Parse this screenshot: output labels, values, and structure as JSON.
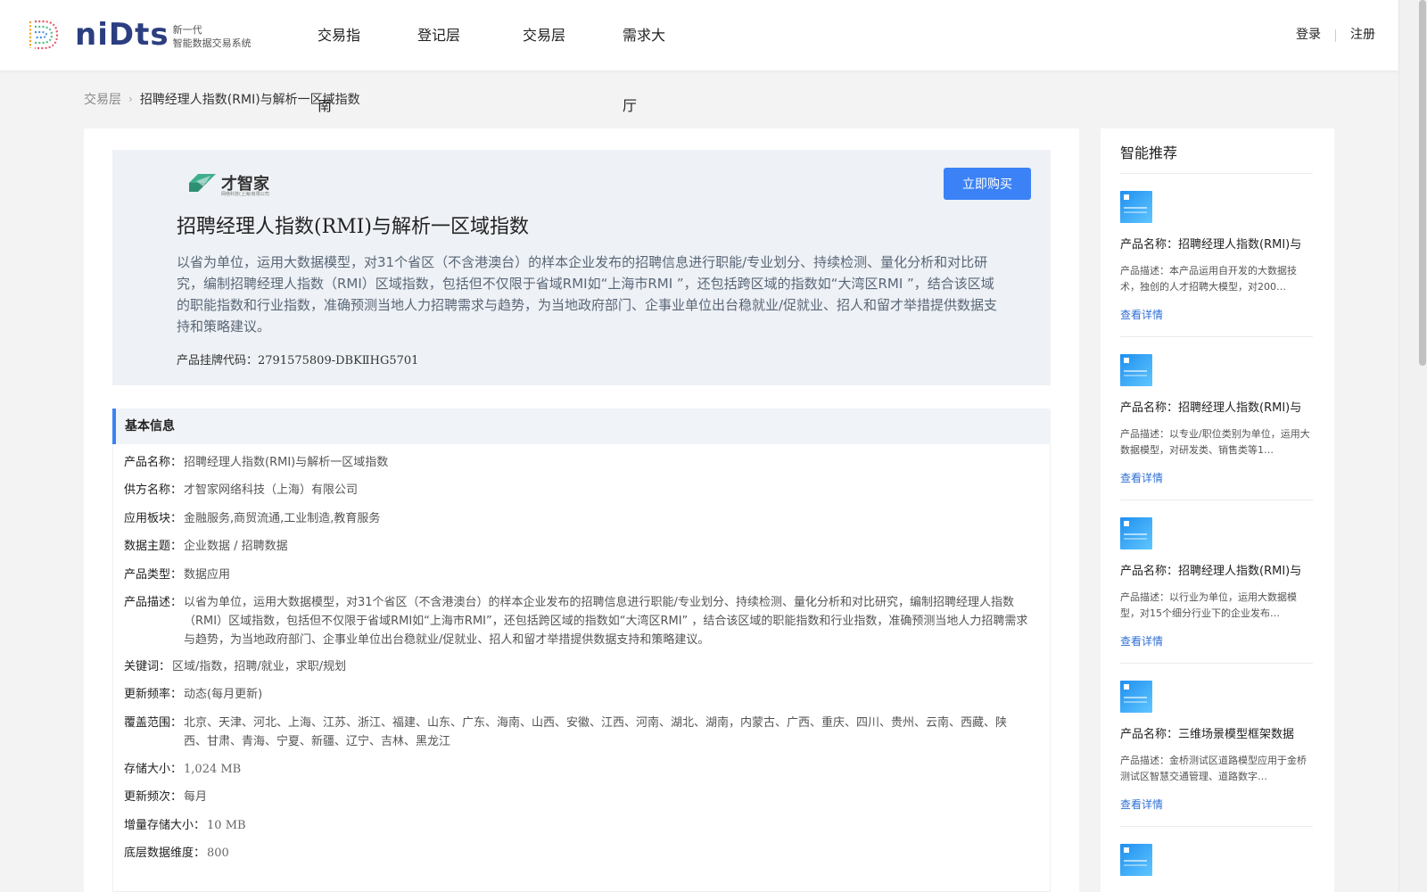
{
  "header": {
    "logo_text": "niDts",
    "logo_sub_line1": "新一代",
    "logo_sub_line2": "智能数据交易系统",
    "nav": [
      "交易指南",
      "登记层",
      "交易层",
      "需求大厅"
    ],
    "login": "登录",
    "register": "注册"
  },
  "breadcrumb": {
    "parent": "交易层",
    "current": "招聘经理人指数(RMI)与解析一区域指数"
  },
  "hero": {
    "brand_name": "才智家",
    "brand_tagline": "网络科技(上海)有限公司",
    "buy_label": "立即购买",
    "title": "招聘经理人指数(RMI)与解析一区域指数",
    "description": "以省为单位，运用大数据模型，对31个省区（不含港澳台）的样本企业发布的招聘信息进行职能/专业划分、持续检测、量化分析和对比研究，编制招聘经理人指数（RMI）区域指数，包括但不仅限于省域RMI如“上海市RMI ”，还包括跨区域的指数如“大湾区RMI ”，结合该区域的职能指数和行业指数，准确预测当地人力招聘需求与趋势，为当地政府部门、企事业单位出台稳就业/促就业、招人和留才举措提供数据支持和策略建议。",
    "code_label": "产品挂牌代码：",
    "code_value": "2791575809-DBKⅡHG5701"
  },
  "basic_info": {
    "heading": "基本信息",
    "rows": [
      {
        "k": "产品名称：",
        "v": "招聘经理人指数(RMI)与解析一区域指数"
      },
      {
        "k": "供方名称：",
        "v": "才智家网络科技（上海）有限公司"
      },
      {
        "k": "应用板块：",
        "v": "金融服务,商贸流通,工业制造,教育服务"
      },
      {
        "k": "数据主题：",
        "v": "企业数据 / 招聘数据"
      },
      {
        "k": "产品类型：",
        "v": "数据应用"
      },
      {
        "k": "产品描述：",
        "v": "以省为单位，运用大数据模型，对31个省区（不含港澳台）的样本企业发布的招聘信息进行职能/专业划分、持续检测、量化分析和对比研究，编制招聘经理人指数（RMI）区域指数，包括但不仅限于省域RMI如“上海市RMI”，还包括跨区域的指数如“大湾区RMI” ，结合该区域的职能指数和行业指数，准确预测当地人力招聘需求与趋势，为当地政府部门、企事业单位出台稳就业/促就业、招人和留才举措提供数据支持和策略建议。"
      },
      {
        "k": "关键词：",
        "v": "区域/指数，招聘/就业，求职/规划"
      },
      {
        "k": "更新频率：",
        "v": "动态(每月更新)"
      },
      {
        "k": "覆盖范围：",
        "v": "北京、天津、河北、上海、江苏、浙江、福建、山东、广东、海南、山西、安徽、江西、河南、湖北、湖南，内蒙古、广西、重庆、四川、贵州、云南、西藏、陕西、甘肃、青海、宁夏、新疆、辽宁、吉林、黑龙江"
      },
      {
        "k": "存储大小：",
        "v": "1,024 MB"
      },
      {
        "k": "更新频次：",
        "v": "每月"
      },
      {
        "k": "增量存储大小：",
        "v": "10 MB"
      },
      {
        "k": "底层数据维度：",
        "v": "800"
      }
    ]
  },
  "sidebar": {
    "title": "智能推荐",
    "items": [
      {
        "name": "产品名称：招聘经理人指数(RMI)与",
        "desc": "产品描述：本产品运用自开发的大数据技术，独创的人才招聘大模型，对200…",
        "link": "查看详情"
      },
      {
        "name": "产品名称：招聘经理人指数(RMI)与",
        "desc": "产品描述：以专业/职位类别为单位，运用大数据模型，对研发类、销售类等1…",
        "link": "查看详情"
      },
      {
        "name": "产品名称：招聘经理人指数(RMI)与",
        "desc": "产品描述：以行业为单位，运用大数据模型，对15个细分行业下的企业发布…",
        "link": "查看详情"
      },
      {
        "name": "产品名称：三维场景模型框架数据",
        "desc": "产品描述：金桥测试区道路模型应用于金桥测试区智慧交通管理、道路数字…",
        "link": "查看详情"
      }
    ]
  },
  "colors": {
    "accent": "#3b82f6",
    "link": "#2f6fd6",
    "hero_bg": "#eef1f5"
  }
}
